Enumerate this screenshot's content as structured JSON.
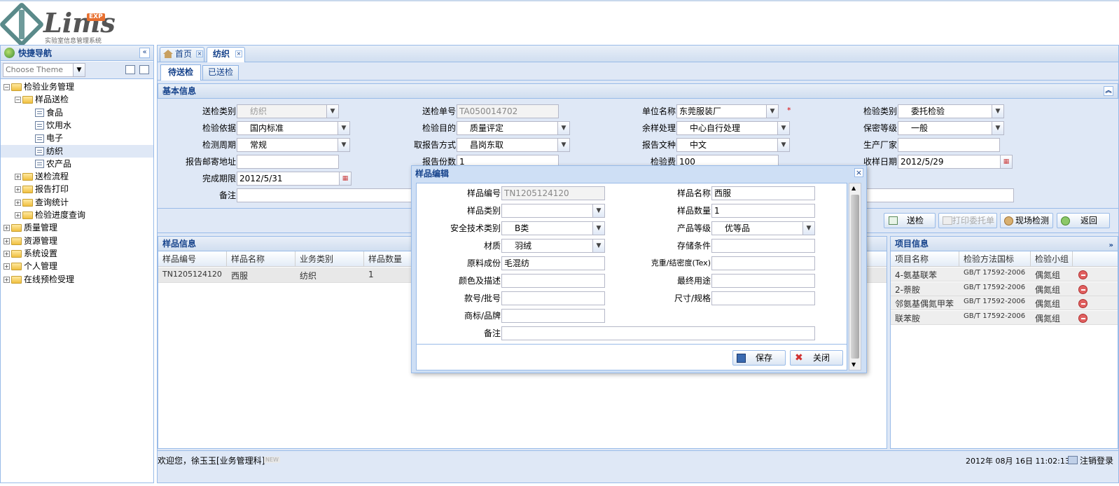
{
  "logo": {
    "text": "Lims",
    "exp": "EXP",
    "subtitle": "实验室信息管理系统"
  },
  "nav": {
    "title": "快捷导航",
    "theme_placeholder": "Choose Theme",
    "tree": [
      {
        "label": "检验业务管理",
        "level": 0,
        "type": "folder",
        "open": true
      },
      {
        "label": "样品送检",
        "level": 1,
        "type": "folder",
        "open": true
      },
      {
        "label": "食品",
        "level": 2,
        "type": "leaf"
      },
      {
        "label": "饮用水",
        "level": 2,
        "type": "leaf"
      },
      {
        "label": "电子",
        "level": 2,
        "type": "leaf"
      },
      {
        "label": "纺织",
        "level": 2,
        "type": "leaf",
        "selected": true
      },
      {
        "label": "农产品",
        "level": 2,
        "type": "leaf"
      },
      {
        "label": "送检流程",
        "level": 1,
        "type": "folder",
        "open": false
      },
      {
        "label": "报告打印",
        "level": 1,
        "type": "folder",
        "open": false
      },
      {
        "label": "查询统计",
        "level": 1,
        "type": "folder",
        "open": false
      },
      {
        "label": "检验进度查询",
        "level": 1,
        "type": "folder",
        "open": false
      },
      {
        "label": "质量管理",
        "level": 0,
        "type": "folder",
        "open": false
      },
      {
        "label": "资源管理",
        "level": 0,
        "type": "folder",
        "open": false
      },
      {
        "label": "系统设置",
        "level": 0,
        "type": "folder",
        "open": false
      },
      {
        "label": "个人管理",
        "level": 0,
        "type": "folder",
        "open": false
      },
      {
        "label": "在线预检受理",
        "level": 0,
        "type": "folder",
        "open": false
      }
    ]
  },
  "tabs": {
    "home": "首页",
    "textile": "纺织"
  },
  "subtabs": {
    "pending": "待送检",
    "sent": "已送检"
  },
  "basic": {
    "title": "基本信息",
    "send_type_label": "送检类别",
    "send_type": "纺织",
    "send_no_label": "送检单号",
    "send_no": "TA050014702",
    "unit_label": "单位名称",
    "unit": "东莞服装厂",
    "required": "*",
    "check_type_label": "检验类别",
    "check_type": "委托检验",
    "basis_label": "检验依据",
    "basis": "国内标准",
    "purpose_label": "检验目的",
    "purpose": "质量评定",
    "remain_label": "余样处理",
    "remain": "中心自行处理",
    "secret_label": "保密等级",
    "secret": "一般",
    "cycle_label": "检测周期",
    "cycle": "常规",
    "report_way_label": "取报告方式",
    "report_way": "昌岗东取",
    "report_lang_label": "报告文种",
    "report_lang": "中文",
    "maker_label": "生产厂家",
    "maker": "",
    "mail_label": "报告邮寄地址",
    "copies_label": "报告份数",
    "copies": "1",
    "fee_label": "检验费",
    "fee": "100",
    "recv_date_label": "收样日期",
    "recv_date": "2012/5/29",
    "deadline_label": "完成期限",
    "deadline": "2012/5/31",
    "remark_label": "备注"
  },
  "actions": {
    "send": "送检",
    "print": "打印委托单",
    "field_test": "现场检测",
    "back": "返回"
  },
  "sample": {
    "title": "样品信息",
    "cols": [
      "样品编号",
      "样品名称",
      "业务类别",
      "样品数量"
    ],
    "rows": [
      [
        "TN1205124120",
        "西服",
        "纺织",
        "1"
      ]
    ]
  },
  "items": {
    "title": "项目信息",
    "cols": [
      "项目名称",
      "检验方法国标",
      "检验小组"
    ],
    "rows": [
      [
        "4-氨基联苯",
        "GB/T 17592-2006",
        "偶氮组"
      ],
      [
        "2-萘胺",
        "GB/T 17592-2006",
        "偶氮组"
      ],
      [
        "邻氨基偶氮甲苯",
        "GB/T 17592-2006",
        "偶氮组"
      ],
      [
        "联苯胺",
        "GB/T 17592-2006",
        "偶氮组"
      ]
    ]
  },
  "dialog": {
    "title": "样品编辑",
    "no_label": "样品编号",
    "no": "TN1205124120",
    "name_label": "样品名称",
    "name": "西服",
    "cat_label": "样品类别",
    "cat": "",
    "qty_label": "样品数量",
    "qty": "1",
    "safety_label": "安全技术类别",
    "safety": "B类",
    "grade_label": "产品等级",
    "grade": "优等品",
    "material_label": "材质",
    "material": "羽绒",
    "storage_label": "存储条件",
    "storage": "",
    "composition_label": "原料成份",
    "composition": "毛混纺",
    "density_label": "克重/结密度(Tex)",
    "density": "",
    "color_label": "颜色及描述",
    "color": "",
    "usage_label": "最终用途",
    "usage": "",
    "style_label": "款号/批号",
    "style": "",
    "size_label": "尺寸/规格",
    "size": "",
    "brand_label": "商标/品牌",
    "brand": "",
    "remark_label": "备注",
    "remark": "",
    "save": "保存",
    "close": "关闭"
  },
  "status": {
    "welcome": "欢迎您，徐玉玉[业务管理科]",
    "new": "NEW",
    "datetime": "2012年 08月 16日 11:02:13",
    "logout": "注销登录"
  }
}
